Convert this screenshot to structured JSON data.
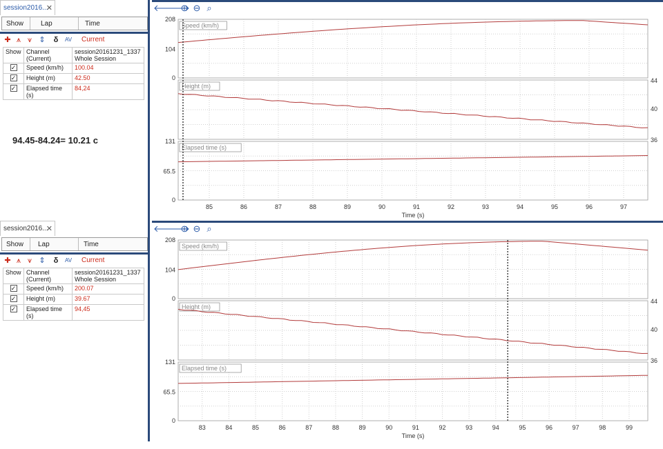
{
  "panels": [
    {
      "tab_label": "session2016...",
      "lap_headers": [
        "Show",
        "Lap",
        "Time"
      ],
      "current_label": "Current",
      "table_headers": {
        "show": "Show",
        "channel": "Channel\n(Current)",
        "session": "session20161231_1337\nWhole Session"
      },
      "channels": [
        {
          "name": "Speed (km/h)",
          "value": "100.04",
          "checked": true
        },
        {
          "name": "Height (m)",
          "value": "42.50",
          "checked": true
        },
        {
          "name": "Elapsed time (s)",
          "value": "84,24",
          "checked": true
        }
      ],
      "note": "94.45-84.24= 10.21 c",
      "chart": {
        "x_min": 84.1,
        "x_max": 97.7,
        "x_ticks": [
          "85",
          "86",
          "87",
          "88",
          "89",
          "90",
          "91",
          "92",
          "93",
          "94",
          "95",
          "96",
          "97"
        ],
        "x_tick_values": [
          85,
          86,
          87,
          88,
          89,
          90,
          91,
          92,
          93,
          94,
          95,
          96,
          97
        ],
        "x_label": "Time (s)",
        "cursor_x": 84.24,
        "subplots": [
          {
            "label": "Speed (km/h)",
            "y_ticks_left": [
              "208",
              "104",
              "0"
            ]
          },
          {
            "label": "Height (m)",
            "y_ticks_right": [
              "44",
              "40",
              "36"
            ]
          },
          {
            "label": "Elapsed time (s)",
            "y_ticks_left": [
              "131",
              "65.5",
              "0"
            ]
          }
        ]
      }
    },
    {
      "tab_label": "session2016...",
      "lap_headers": [
        "Show",
        "Lap",
        "Time"
      ],
      "current_label": "Current",
      "table_headers": {
        "show": "Show",
        "channel": "Channel\n(Current)",
        "session": "session20161231_1337\nWhole Session"
      },
      "channels": [
        {
          "name": "Speed (km/h)",
          "value": "200.07",
          "checked": true
        },
        {
          "name": "Height (m)",
          "value": "39.67",
          "checked": true
        },
        {
          "name": "Elapsed time (s)",
          "value": "94,45",
          "checked": true
        }
      ],
      "note": "",
      "chart": {
        "x_min": 82.1,
        "x_max": 99.7,
        "x_ticks": [
          "83",
          "84",
          "85",
          "86",
          "87",
          "88",
          "89",
          "90",
          "91",
          "92",
          "93",
          "94",
          "95",
          "96",
          "97",
          "98",
          "99"
        ],
        "x_tick_values": [
          83,
          84,
          85,
          86,
          87,
          88,
          89,
          90,
          91,
          92,
          93,
          94,
          95,
          96,
          97,
          98,
          99
        ],
        "x_label": "Time (s)",
        "cursor_x": 94.45,
        "subplots": [
          {
            "label": "Speed (km/h)",
            "y_ticks_left": [
              "208",
              "104",
              "0"
            ]
          },
          {
            "label": "Height (m)",
            "y_ticks_right": [
              "44",
              "40",
              "36"
            ]
          },
          {
            "label": "Elapsed time (s)",
            "y_ticks_left": [
              "131",
              "65.5",
              "0"
            ]
          }
        ]
      }
    }
  ]
}
